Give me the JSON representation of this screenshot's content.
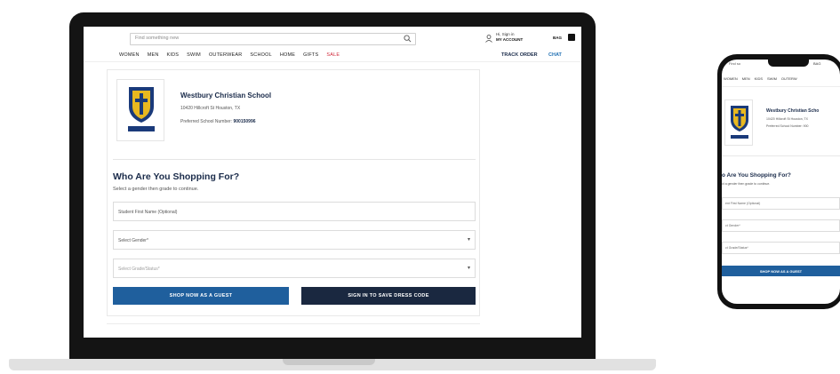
{
  "header": {
    "search_placeholder": "Find something new",
    "account_greeting": "Hi, Sign in",
    "account_label": "MY ACCOUNT",
    "bag_label": "BAG",
    "nav": [
      "WOMEN",
      "MEN",
      "KIDS",
      "SWIM",
      "OUTERWEAR",
      "SCHOOL",
      "HOME",
      "GIFTS",
      "SALE"
    ],
    "track_order": "TRACK ORDER",
    "chat": "CHAT"
  },
  "school": {
    "name": "Westbury Christian School",
    "address": "10420 Hillcroft St Houston, TX",
    "number_label": "Preferred School Number:",
    "number_value": "900150996",
    "logo_text": "WESTBURY CHRISTIAN"
  },
  "form": {
    "title": "Who Are You Shopping For?",
    "subtitle": "Select a gender then grade to continue.",
    "name_placeholder": "Student First Name (Optional)",
    "gender_placeholder": "Select Gender*",
    "grade_placeholder": "Select Grade/Status*",
    "guest_button": "SHOP NOW AS A GUEST",
    "sign_in_button": "SIGN IN TO SAVE DRESS CODE"
  },
  "phone": {
    "status_left": "Find so",
    "status_right": "BAG",
    "nav": [
      "WOMEN",
      "MEN",
      "KIDS",
      "SWIM",
      "OUTERW"
    ],
    "school_name": "Westbury Christian Scho",
    "address": "10420 Hillcroft St Houston, TX",
    "number": "Preferred School Number: 900",
    "title": "o Are You Shopping For?",
    "subtitle": "ct a gender then grade to continue.",
    "name_placeholder": "ent First Name (Optional)",
    "gender_placeholder": "ct Gender*",
    "grade_placeholder": "ct Grade/Status*",
    "guest_button": "SHOP NOW AS A GUEST"
  },
  "colors": {
    "navy": "#1a2b4a",
    "primary_blue": "#1f5f9d",
    "dark_button": "#1a2840",
    "sale_red": "#d0293b"
  }
}
